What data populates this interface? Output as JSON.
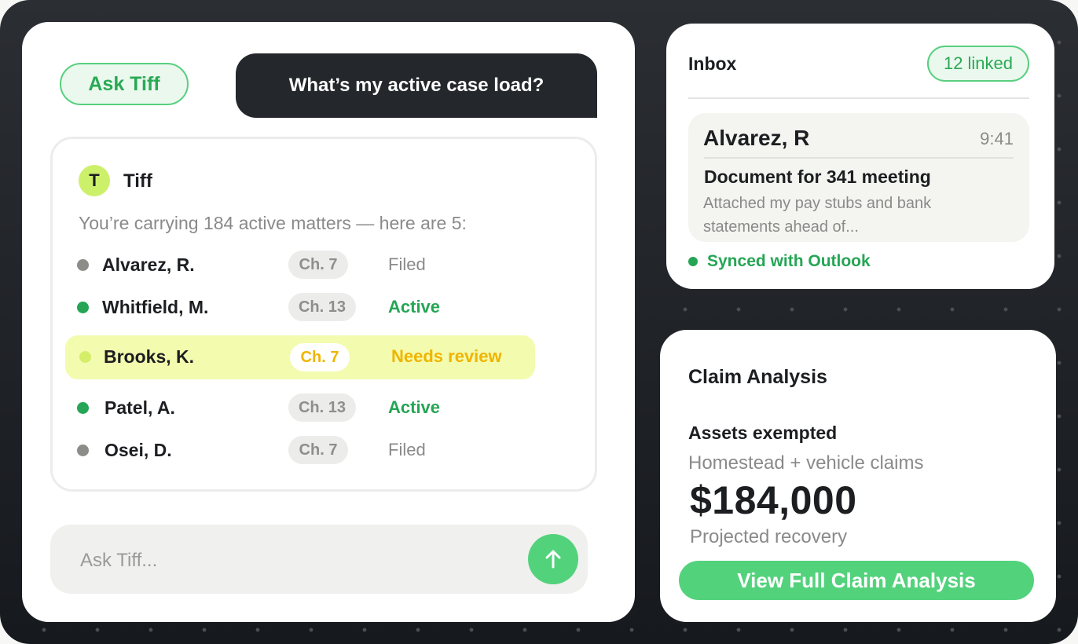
{
  "chat": {
    "ask_pill_label": "Ask Tiff",
    "user_question": "What’s my active case load?",
    "assistant": {
      "avatar_initial": "T",
      "name": "Tiff",
      "intro": "You’re carrying 184 active matters — here are 5:"
    },
    "cases": [
      {
        "client": "Alvarez, R.",
        "chapter": "Ch. 7",
        "status": "Filed",
        "status_color": "#8a8a8a",
        "dot_color": "#8c8c88"
      },
      {
        "client": "Whitfield, M.",
        "chapter": "Ch. 13",
        "status": "Active",
        "status_color": "#25a555",
        "dot_color": "#25a555"
      },
      {
        "client": "Brooks, K.",
        "chapter": "Ch. 7",
        "status": "Needs review",
        "status_color": "#f0b400",
        "dot_color": "#d4ee6a",
        "highlighted": true
      },
      {
        "client": "Patel, A.",
        "chapter": "Ch. 13",
        "status": "Active",
        "status_color": "#25a555",
        "dot_color": "#25a555"
      },
      {
        "client": "Osei, D.",
        "chapter": "Ch. 7",
        "status": "Filed",
        "status_color": "#8a8a8a",
        "dot_color": "#8c8c88"
      }
    ],
    "composer": {
      "placeholder": "Ask Tiff...",
      "send_icon": "arrow-up-icon"
    }
  },
  "inbox": {
    "title": "Inbox",
    "linked_badge": "12 linked",
    "message": {
      "sender": "Alvarez, R",
      "time": "9:41",
      "subject": "Document for 341 meeting",
      "preview": "Attached my pay stubs and bank statements ahead of..."
    },
    "sync_status": "Synced with Outlook"
  },
  "claim": {
    "title": "Claim Analysis",
    "assets_label": "Assets exempted",
    "assets_subtitle": "Homestead + vehicle claims",
    "amount": "$184,000",
    "amount_label": "Projected recovery",
    "cta_label": "View Full Claim Analysis"
  },
  "colors": {
    "accent_green": "#53d27c",
    "status_green": "#25a555",
    "highlight": "#f3fbae",
    "warning": "#f0b400",
    "dark": "#24272b"
  }
}
